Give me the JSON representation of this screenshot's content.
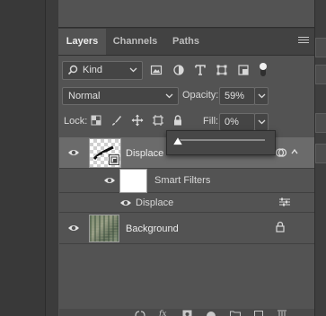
{
  "panel": {
    "tabs": [
      {
        "label": "Layers",
        "active": true
      },
      {
        "label": "Channels",
        "active": false
      },
      {
        "label": "Paths",
        "active": false
      }
    ],
    "menu_icon": "hamburger-icon"
  },
  "filter": {
    "kind_label": "Kind",
    "icons": [
      "pixel-filter-icon",
      "adjustment-filter-icon",
      "type-filter-icon",
      "shape-filter-icon",
      "smart-object-filter-icon",
      "filter-toggle-icon"
    ]
  },
  "blend": {
    "mode": "Normal",
    "opacity_label": "Opacity:",
    "opacity_value": "59%"
  },
  "lock": {
    "label": "Lock:",
    "icons": [
      "lock-transparent-pixels-icon",
      "lock-image-pixels-icon",
      "lock-position-icon",
      "lock-artboard-icon",
      "lock-all-icon"
    ],
    "fill_label": "Fill:",
    "fill_value": "0%"
  },
  "fill_slider": {
    "value_percent": 0
  },
  "layers": [
    {
      "name": "Displace",
      "type": "smart-object",
      "visible": true,
      "selected": true
    },
    {
      "name": "Smart Filters",
      "type": "smart-filters",
      "visible": true
    },
    {
      "name": "Displace",
      "type": "filter-effect",
      "visible": true
    },
    {
      "name": "Background",
      "type": "background",
      "visible": true,
      "locked": true
    }
  ],
  "colors": {
    "panel_bg": "#535353",
    "selected_row": "#6b6b6b",
    "tab_bar": "#424242",
    "text": "#d8d8d8"
  }
}
